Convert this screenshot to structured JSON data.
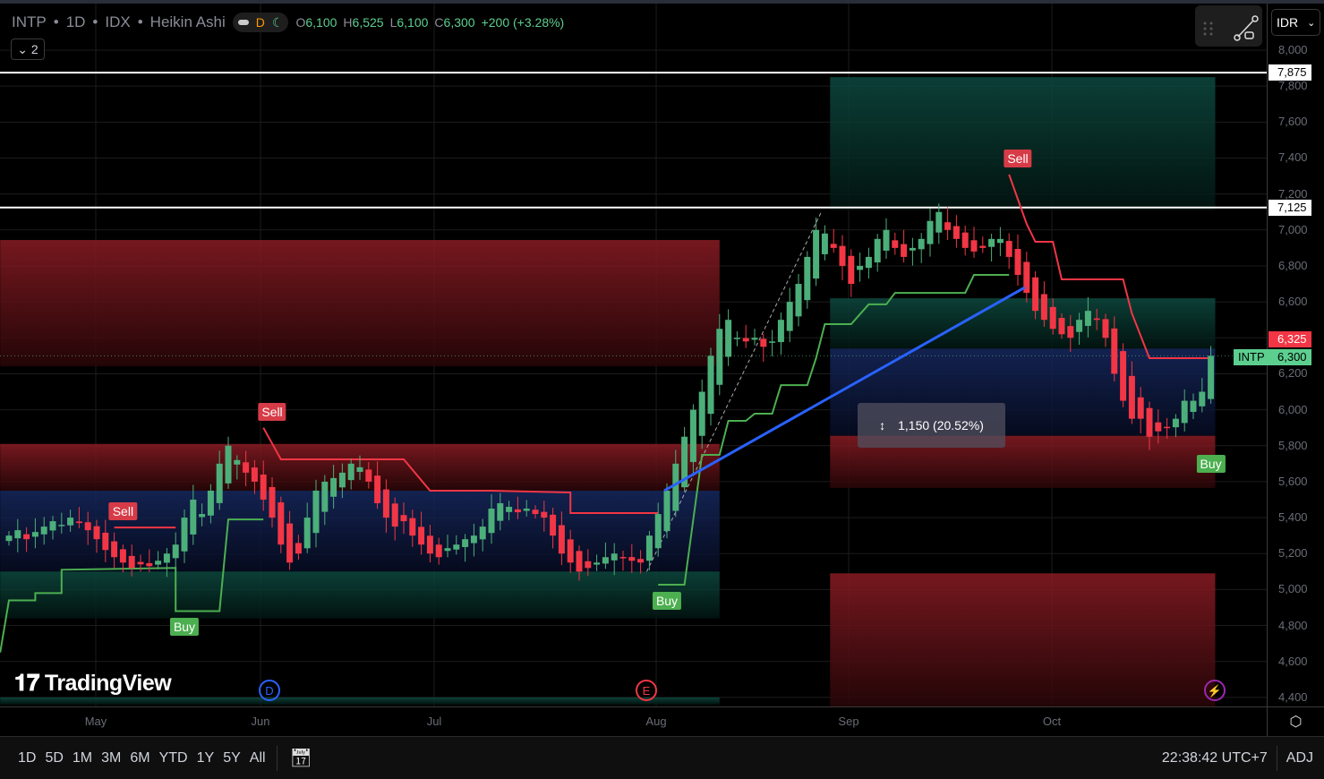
{
  "legend": {
    "symbol": "INTP",
    "interval": "1D",
    "exchange": "IDX",
    "chart_type": "Heikin Ashi",
    "sep": "•",
    "session_badge": "D",
    "open_label": "O",
    "open": "6,100",
    "high_label": "H",
    "high": "6,525",
    "low_label": "L",
    "low": "6,100",
    "close_label": "C",
    "close": "6,300",
    "change": "+200 (+3.28%)",
    "collapse_count": "2"
  },
  "currency": "IDR",
  "price_axis": {
    "ticks": [
      "8,000",
      "7,800",
      "7,600",
      "7,400",
      "7,200",
      "7,000",
      "6,800",
      "6,600",
      "6,400",
      "6,200",
      "6,000",
      "5,800",
      "5,600",
      "5,400",
      "5,200",
      "5,000",
      "4,800",
      "4,600",
      "4,400"
    ],
    "tags": {
      "line_high": "7,875",
      "line_mid": "7,125",
      "red_tag": "6,325",
      "symbol_tag": "INTP",
      "last_price": "6,300"
    }
  },
  "time_axis": [
    "May",
    "Jun",
    "Jul",
    "Aug",
    "Sep",
    "Oct"
  ],
  "measure_label": "1,150 (20.52%)",
  "watermark": "TradingView",
  "events": {
    "dividend": "D",
    "earnings": "E"
  },
  "bottom": {
    "ranges": [
      "1D",
      "5D",
      "1M",
      "3M",
      "6M",
      "YTD",
      "1Y",
      "5Y",
      "All"
    ],
    "clock": "22:38:42 UTC+7",
    "adj": "ADJ"
  },
  "colors": {
    "up": "#4caf7a",
    "down": "#f23645",
    "supertrend_up": "#4caf50",
    "supertrend_down": "#f23645",
    "measure": "#2962ff"
  },
  "chart_data": {
    "type": "candlestick-heikin-ashi",
    "ylim": [
      4400,
      8000
    ],
    "ha_close": [
      5300,
      5330,
      5280,
      5320,
      5350,
      5380,
      5360,
      5400,
      5370,
      5330,
      5280,
      5220,
      5180,
      5150,
      5120,
      5140,
      5130,
      5160,
      5200,
      5250,
      5400,
      5500,
      5420,
      5550,
      5700,
      5800,
      5720,
      5650,
      5600,
      5500,
      5400,
      5250,
      5150,
      5200,
      5400,
      5550,
      5600,
      5620,
      5650,
      5700,
      5680,
      5600,
      5480,
      5400,
      5350,
      5380,
      5300,
      5250,
      5200,
      5180,
      5230,
      5250,
      5280,
      5300,
      5350,
      5450,
      5480,
      5460,
      5430,
      5450,
      5420,
      5400,
      5300,
      5200,
      5150,
      5100,
      5120,
      5150,
      5180,
      5200,
      5180,
      5160,
      5150,
      5300,
      5420,
      5550,
      5700,
      5850,
      6000,
      6100,
      6300,
      6450,
      6500,
      6400,
      6380,
      6400,
      6350,
      6380,
      6500,
      6600,
      6700,
      6850,
      7000,
      6980,
      6900,
      6800,
      6700,
      6800,
      6850,
      6950,
      7000,
      6900,
      6850,
      6900,
      6950,
      7050,
      7100,
      7000,
      6950,
      6900,
      6880,
      6900,
      6950,
      6950,
      6850,
      6750,
      6650,
      6550,
      6500,
      6450,
      6420,
      6400,
      6500,
      6550,
      6500,
      6400,
      6200,
      6050,
      5950,
      5950,
      5850,
      5880,
      5900,
      5950,
      6050,
      6050,
      6100,
      6300
    ],
    "supertrend": [
      {
        "dir": "up",
        "pts": [
          [
            -1,
            4650
          ],
          [
            0,
            4940
          ],
          [
            3,
            4940
          ],
          [
            3,
            4980
          ],
          [
            6,
            4980
          ],
          [
            6,
            5110
          ],
          [
            19,
            5120
          ],
          [
            19,
            4880
          ],
          [
            24,
            4880
          ],
          [
            25,
            5390
          ],
          [
            29,
            5390
          ]
        ]
      },
      {
        "dir": "down",
        "pts": [
          [
            12,
            5345
          ],
          [
            19,
            5345
          ]
        ]
      },
      {
        "dir": "down",
        "pts": [
          [
            29,
            5900
          ],
          [
            31,
            5724
          ],
          [
            45,
            5724
          ],
          [
            48,
            5550
          ],
          [
            55,
            5550
          ],
          [
            64,
            5540
          ],
          [
            64,
            5425
          ],
          [
            74,
            5425
          ]
        ]
      },
      {
        "dir": "up",
        "pts": [
          [
            74,
            5027
          ],
          [
            77,
            5027
          ],
          [
            79,
            5749
          ],
          [
            81,
            5749
          ],
          [
            82,
            5938
          ],
          [
            84,
            5938
          ],
          [
            85,
            5978
          ],
          [
            87,
            5978
          ],
          [
            88,
            6137
          ],
          [
            91,
            6137
          ],
          [
            92,
            6287
          ],
          [
            93,
            6476
          ],
          [
            96,
            6476
          ],
          [
            98,
            6586
          ],
          [
            100,
            6586
          ],
          [
            101,
            6650
          ],
          [
            109,
            6650
          ],
          [
            110,
            6750
          ],
          [
            114,
            6750
          ]
        ]
      },
      {
        "dir": "down",
        "pts": [
          [
            114,
            7308
          ],
          [
            116,
            7034
          ],
          [
            117,
            6934
          ],
          [
            119,
            6934
          ],
          [
            120,
            6725
          ],
          [
            127,
            6725
          ],
          [
            128,
            6536
          ],
          [
            130,
            6287
          ],
          [
            137,
            6287
          ]
        ]
      }
    ],
    "signals": [
      {
        "label": "Sell",
        "i": 13,
        "price": 5345
      },
      {
        "label": "Buy",
        "i": 20,
        "price": 4880
      },
      {
        "label": "Sell",
        "i": 30,
        "price": 5900
      },
      {
        "label": "Buy",
        "i": 75,
        "price": 5027
      },
      {
        "label": "Sell",
        "i": 115,
        "price": 7308
      },
      {
        "label": "Buy",
        "i": 137,
        "price": 5790
      }
    ],
    "zones": [
      {
        "kind": "red",
        "from": -1,
        "to": 81,
        "top": 6944,
        "bottom": 6242
      },
      {
        "kind": "red",
        "from": -1,
        "to": 81,
        "top": 5810,
        "bottom": 5550
      },
      {
        "kind": "blue",
        "from": -1,
        "to": 81,
        "top": 5550,
        "bottom": 5100
      },
      {
        "kind": "teal",
        "from": -1,
        "to": 81,
        "top": 5100,
        "bottom": 4840
      },
      {
        "kind": "teal",
        "from": -1,
        "to": 81,
        "top": 4400,
        "bottom": 4360
      },
      {
        "kind": "teal",
        "from": 93.6,
        "to": 137.5,
        "top": 7850,
        "bottom": 7110
      },
      {
        "kind": "teal",
        "from": 93.6,
        "to": 137.5,
        "top": 6620,
        "bottom": 6340
      },
      {
        "kind": "blue",
        "from": 93.6,
        "to": 137.5,
        "top": 6340,
        "bottom": 5855
      },
      {
        "kind": "red",
        "from": 93.6,
        "to": 137.5,
        "top": 5855,
        "bottom": 5565
      },
      {
        "kind": "red",
        "from": 93.6,
        "to": 137.5,
        "top": 5090,
        "bottom": 4350
      }
    ],
    "hlines": [
      7875,
      7125
    ],
    "last_price": 6300,
    "measure": {
      "from": [
        74.7,
        5550
      ],
      "to": [
        115.8,
        6680
      ]
    },
    "trendline": {
      "from": [
        72.7,
        5100
      ],
      "to": [
        92.6,
        7100
      ]
    }
  }
}
